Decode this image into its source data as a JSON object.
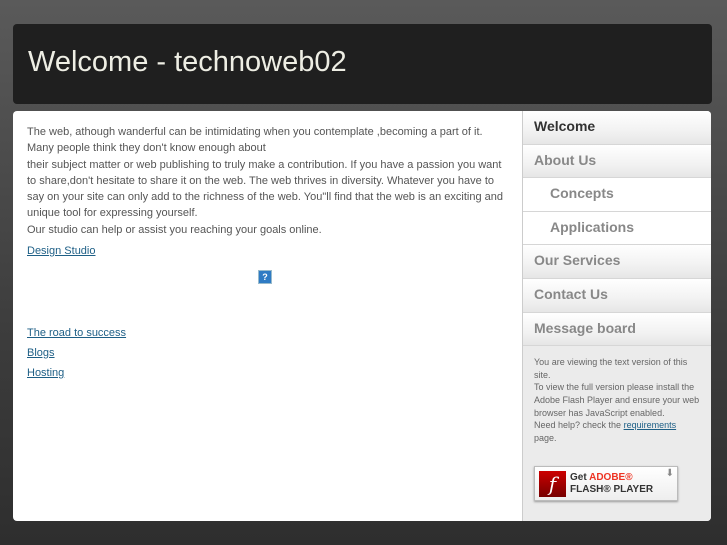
{
  "header": {
    "title": "Welcome - technoweb02"
  },
  "main": {
    "paragraphs": [
      "The web, athough wanderful can be intimidating when you contemplate ,becoming a part of it. Many people think they don't know enough about",
      "their subject matter or web publishing to truly make a contribution. If you have a passion you want to share,don't hesitate to share it on the web. The web thrives in diversity. Whatever you have to say on your site can only add to the richness of the web. You\"ll find that the web is an exciting and unique tool for expressing yourself.",
      "Our studio can help or assist you reaching your goals online."
    ],
    "design_link": "Design Studio",
    "help_icon": "?",
    "links": [
      "The road to success",
      "Blogs",
      "Hosting"
    ]
  },
  "nav": [
    "Welcome",
    "About Us",
    "Concepts",
    "Applications",
    "Our Services",
    "Contact Us",
    "Message board"
  ],
  "note": {
    "text1": "You are viewing the text version of this site.",
    "text2": "To view the full version please install the Adobe Flash Player and ensure your web browser has JavaScript enabled.",
    "text3": "Need help? check the",
    "link": "requirements",
    "text4": "page."
  },
  "flash": {
    "get": "Get",
    "adobe": "ADOBE®",
    "player": "FLASH® PLAYER",
    "logo": "f",
    "arrow": "⬇"
  }
}
